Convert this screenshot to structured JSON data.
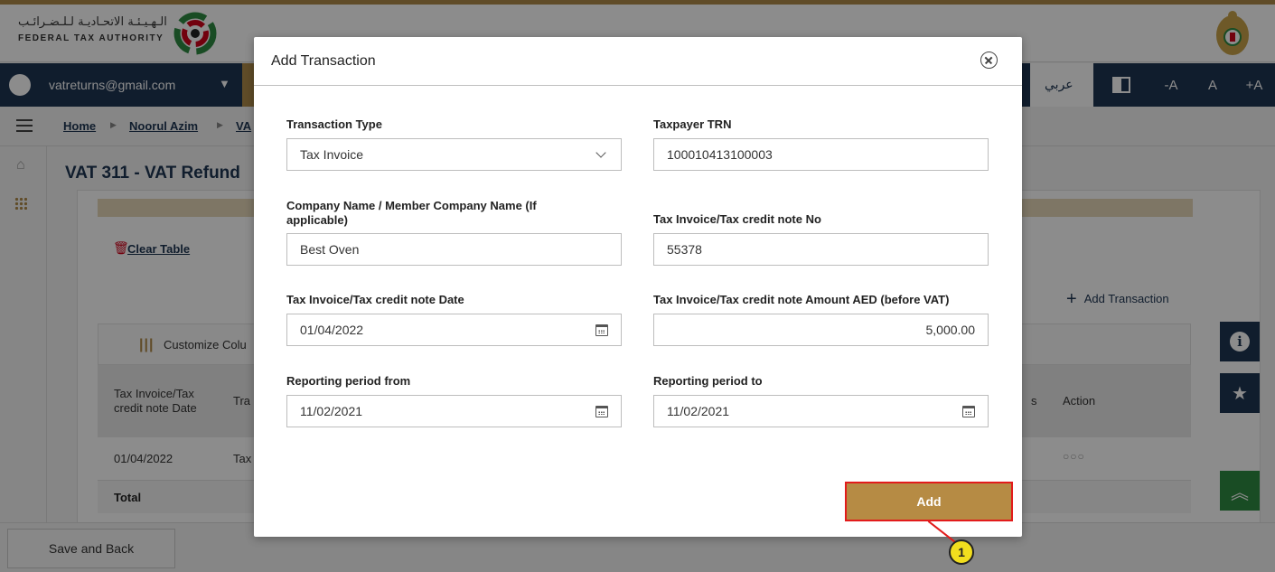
{
  "header": {
    "logo_arabic": "الـهـيـئـة الاتحـاديـة لـلـضـرائـب",
    "logo_english": "FEDERAL TAX AUTHORITY"
  },
  "navbar": {
    "user_email": "vatreturns@gmail.com",
    "arabic_label": "عربي",
    "font_decrease": "-A",
    "font_normal": "A",
    "font_increase": "+A"
  },
  "breadcrumb": {
    "items": [
      "Home",
      "Noorul Azim",
      "VA"
    ]
  },
  "page": {
    "title": "VAT 311 - VAT Refund",
    "clear_table": "Clear Table",
    "add_transaction": "Add Transaction",
    "customize_columns": "Customize Colu",
    "table": {
      "headers": {
        "col1": "Tax Invoice/Tax credit note Date",
        "col2": "Tra",
        "col_status": "s",
        "col_action": "Action"
      },
      "row": {
        "date": "01/04/2022",
        "type": "Tax"
      },
      "total_label": "Total"
    },
    "save_and_back": "Save and Back"
  },
  "modal": {
    "title": "Add Transaction",
    "fields": {
      "transaction_type": {
        "label": "Transaction Type",
        "value": "Tax Invoice"
      },
      "taxpayer_trn": {
        "label": "Taxpayer TRN",
        "value": "100010413100003"
      },
      "company_name": {
        "label": "Company Name / Member Company Name (If applicable)",
        "value": "Best Oven"
      },
      "invoice_no": {
        "label": "Tax Invoice/Tax credit note No",
        "value": "55378"
      },
      "invoice_date": {
        "label": "Tax Invoice/Tax credit note Date",
        "value": "01/04/2022"
      },
      "invoice_amount": {
        "label": "Tax Invoice/Tax credit note Amount AED (before VAT)",
        "value": "5,000.00"
      },
      "period_from": {
        "label": "Reporting period from",
        "value": "11/02/2021"
      },
      "period_to": {
        "label": "Reporting period to",
        "value": "11/02/2021"
      }
    },
    "add_button": "Add"
  },
  "callout": {
    "number": "1"
  },
  "colors": {
    "navy": "#1e3553",
    "gold": "#b68b44",
    "highlight_red": "#e21b1b",
    "callout_yellow": "#f2de1e",
    "green": "#2f8a43"
  }
}
